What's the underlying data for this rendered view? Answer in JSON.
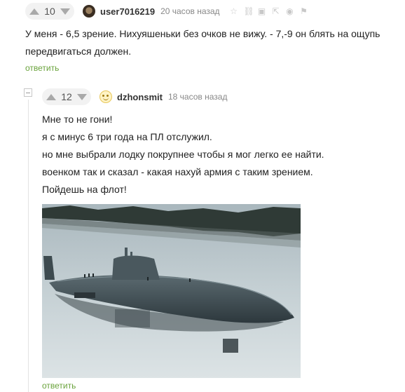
{
  "comment1": {
    "score": "10",
    "username": "user7016219",
    "time": "20 часов назад",
    "text": "У меня - 6,5 зрение. Нихуяшеньки без очков не вижу. - 7,-9 он блять на ощупь передвигаться должен.",
    "reply_label": "ответить"
  },
  "comment2": {
    "score": "12",
    "username": "dzhonsmit",
    "time": "18 часов назад",
    "lines": [
      "Мне то не гони!",
      "я с минус 6 три года на ПЛ отслужил.",
      "но мне выбрали лодку покрупнее чтобы я мог легко ее найти.",
      "военком так и сказал - какая нахуй армия с таким зрением.",
      "Пойдешь на флот!"
    ],
    "reply_label": "ответить"
  },
  "icons": {
    "vote_up": "arrow-up-icon",
    "vote_down": "arrow-down-icon",
    "tools": [
      "bookmark-icon",
      "link-icon",
      "save-icon",
      "share-icon",
      "report-icon",
      "flag-icon"
    ],
    "collapse": "collapse-icon"
  },
  "colors": {
    "reply_link": "#6aa33c",
    "arrow": "#a9a9a9",
    "meta_text": "#888888"
  }
}
